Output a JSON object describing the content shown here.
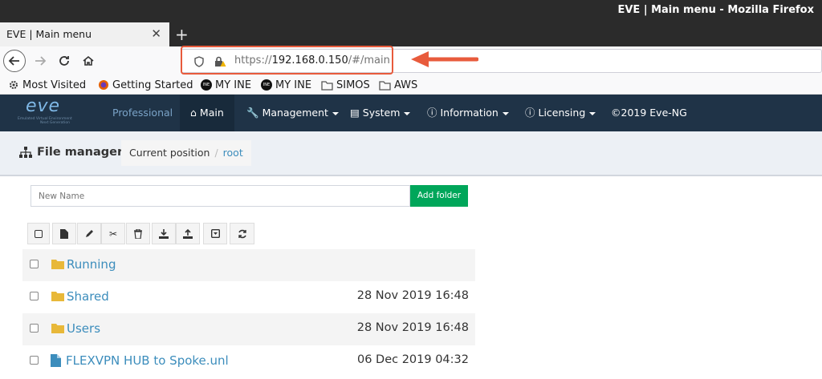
{
  "window": {
    "title": "EVE | Main menu - Mozilla Firefox"
  },
  "tabs": [
    {
      "label": "EVE | Main menu"
    }
  ],
  "address": {
    "scheme": "https://",
    "host": "192.168.0.150",
    "path": "/#/main"
  },
  "bookmarks": [
    {
      "label": "Most Visited",
      "icon": "gear-icon"
    },
    {
      "label": "Getting Started",
      "icon": "firefox-icon"
    },
    {
      "label": "MY INE",
      "icon": "ine-icon"
    },
    {
      "label": "MY INE",
      "icon": "ine-icon"
    },
    {
      "label": "SIMOS",
      "icon": "folder-icon"
    },
    {
      "label": "AWS",
      "icon": "folder-icon"
    }
  ],
  "eve_nav": {
    "logo": "eve",
    "logo_tagline": "Emulated Virtual Environment",
    "logo_tagline2": "Next Generation",
    "edition": "Professional",
    "main": "Main",
    "management": "Management",
    "system": "System",
    "information": "Information",
    "licensing": "Licensing",
    "copyright": "©2019 Eve-NG"
  },
  "file_manager": {
    "title": "File manager",
    "breadcrumb_label": "Current position",
    "breadcrumb_current": "root",
    "new_name_placeholder": "New Name",
    "add_folder": "Add folder",
    "rows": [
      {
        "name": "Running",
        "date": "",
        "type": "folder"
      },
      {
        "name": "Shared",
        "date": "28 Nov 2019 16:48",
        "type": "folder"
      },
      {
        "name": "Users",
        "date": "28 Nov 2019 16:48",
        "type": "folder"
      },
      {
        "name": "FLEXVPN HUB to Spoke.unl",
        "date": "06 Dec 2019 04:32",
        "type": "file"
      }
    ]
  },
  "colors": {
    "eve_nav_bg": "#1f3347",
    "add_folder_green": "#00a65a",
    "link_blue": "#3c8dbc",
    "highlight_red": "#e85b3c",
    "folder_yellow": "#e8b839"
  }
}
